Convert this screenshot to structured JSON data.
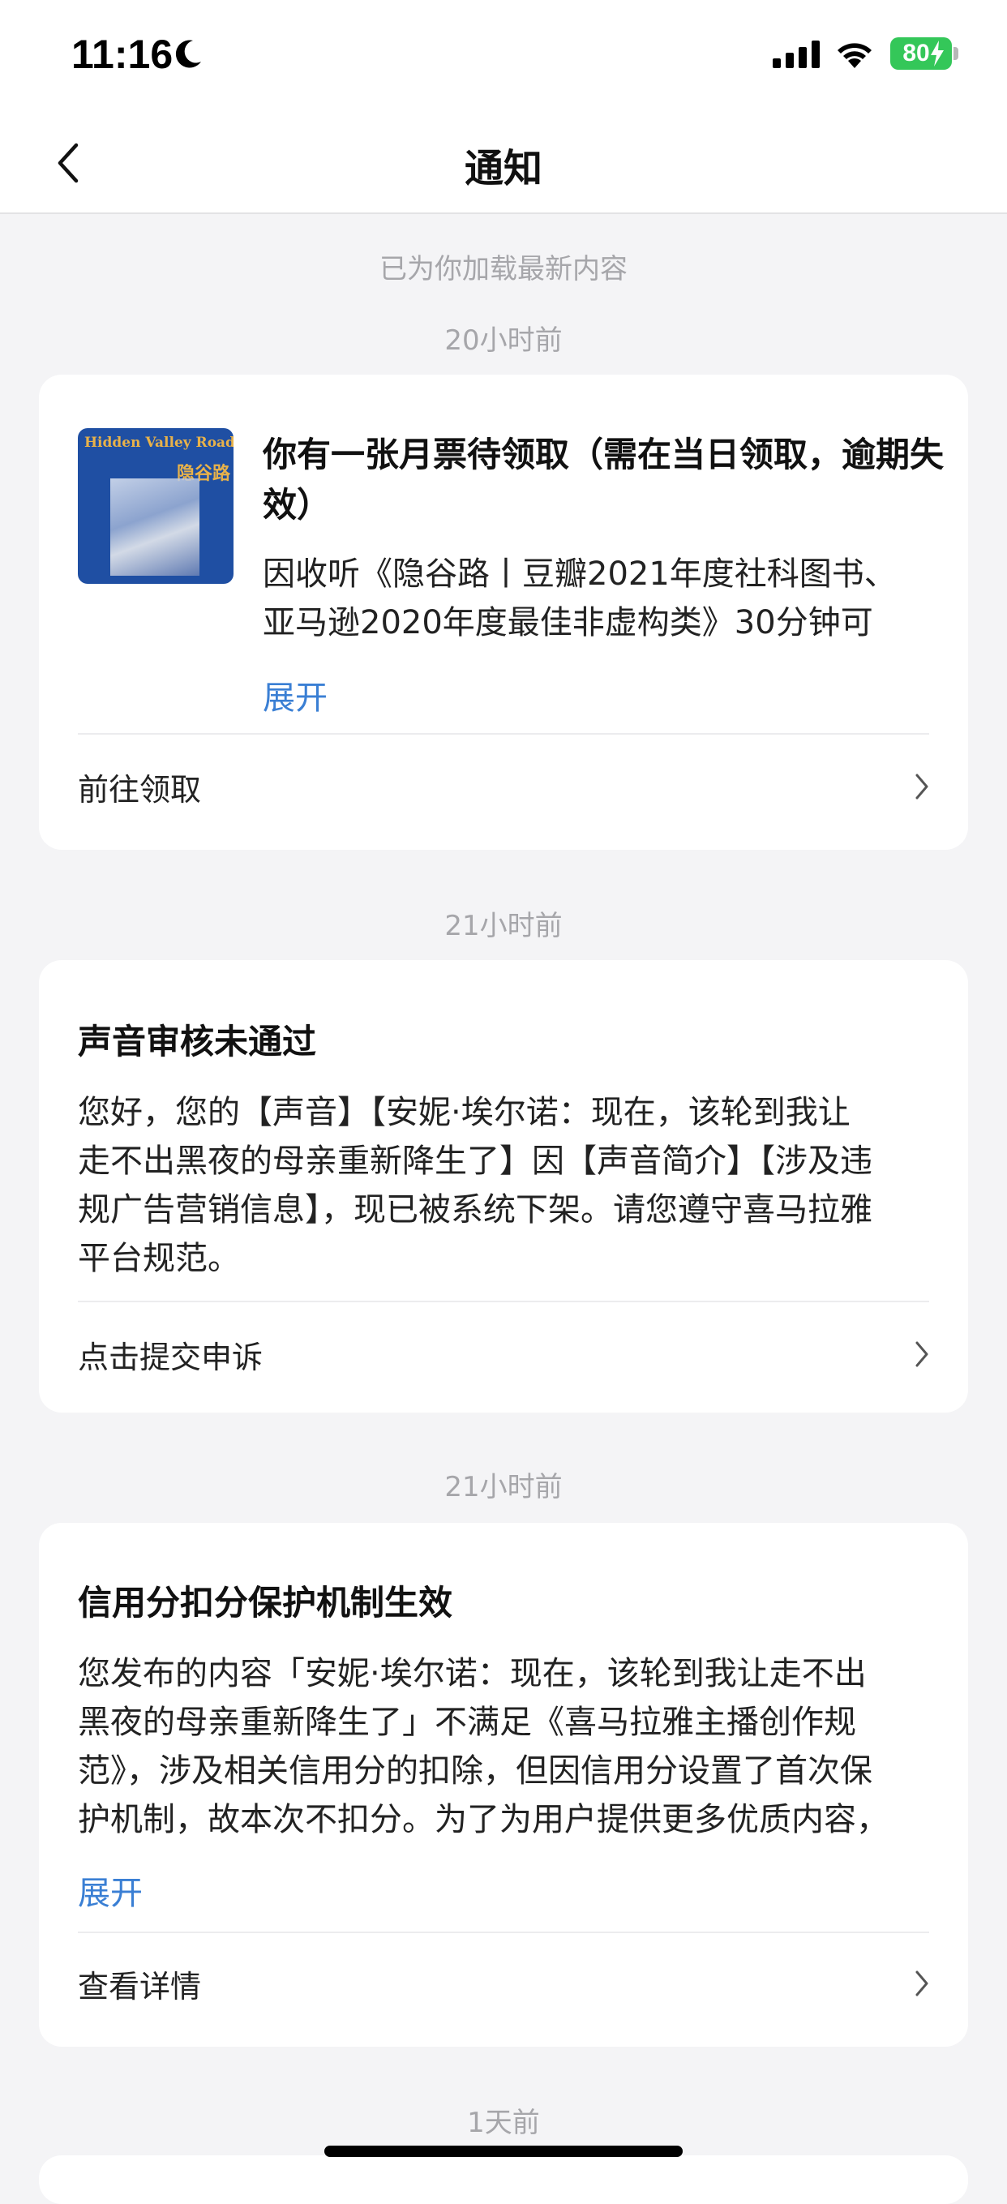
{
  "status_bar": {
    "time": "11:16",
    "battery": "80",
    "colors": {
      "battery": "#34c759"
    }
  },
  "nav": {
    "title": "通知",
    "back_icon": "chevron-left-icon"
  },
  "feed": {
    "load_hint": "已为你加载最新内容",
    "notifications": [
      {
        "time": "20小时前",
        "title": "你有一张月票待领取（需在当日领取，逾期失效）",
        "body_lines": [
          "因收听《隐谷路丨豆瓣2021年度社科图书、",
          "亚马逊2020年度最佳非虚构类》30分钟可"
        ],
        "expand": "展开",
        "action": "前往领取",
        "cover": {
          "title_en": "Hidden Valley Road",
          "title_cn": "隐谷路"
        }
      },
      {
        "time": "21小时前",
        "title": "声音审核未通过",
        "body_lines": [
          "您好，您的【声音】【安妮·埃尔诺：现在，该轮到我让",
          "走不出黑夜的母亲重新降生了】因【声音简介】【涉及违",
          "规广告营销信息】，现已被系统下架。请您遵守喜马拉雅",
          "平台规范。"
        ],
        "action": "点击提交申诉"
      },
      {
        "time": "21小时前",
        "title": "信用分扣分保护机制生效",
        "body_lines": [
          "您发布的内容「安妮·埃尔诺：现在，该轮到我让走不出",
          "黑夜的母亲重新降生了」不满足《喜马拉雅主播创作规",
          "范》，涉及相关信用分的扣除，但因信用分设置了首次保",
          "护机制，故本次不扣分。为了为用户提供更多优质内容，"
        ],
        "expand": "展开",
        "action": "查看详情"
      },
      {
        "time": "1天前"
      }
    ],
    "colors": {
      "link": "#3a7fd4",
      "timestamp": "#a6a6aa"
    }
  }
}
